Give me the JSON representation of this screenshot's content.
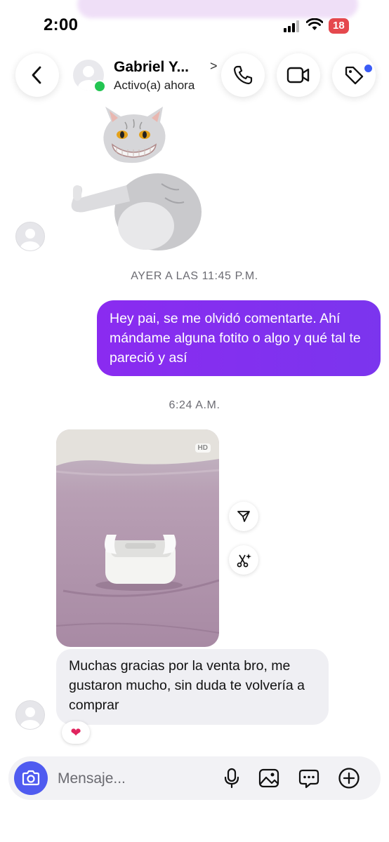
{
  "status_bar": {
    "time": "2:00",
    "battery": "18"
  },
  "header": {
    "contact_name": "Gabriel Y...",
    "chevron": ">",
    "status": "Activo(a) ahora"
  },
  "chat": {
    "timestamp_1": "AYER A LAS 11:45 P.M.",
    "outgoing_message": "Hey pai, se me olvidó comentarte. Ahí mándame alguna fotito o algo y qué tal te pareció y así",
    "timestamp_2": "6:24 A.M.",
    "photo_badge": "HD",
    "incoming_message": "Muchas gracias por la venta bro, me gustaron mucho, sin duda te volvería a comprar",
    "reaction": "❤"
  },
  "composer": {
    "placeholder": "Mensaje..."
  },
  "colors": {
    "outgoing_bubble": "#8a2bf0",
    "incoming_bubble": "#efeff3",
    "online": "#23c552",
    "camera_button": "#4f5bf0",
    "battery": "#e5484d"
  }
}
